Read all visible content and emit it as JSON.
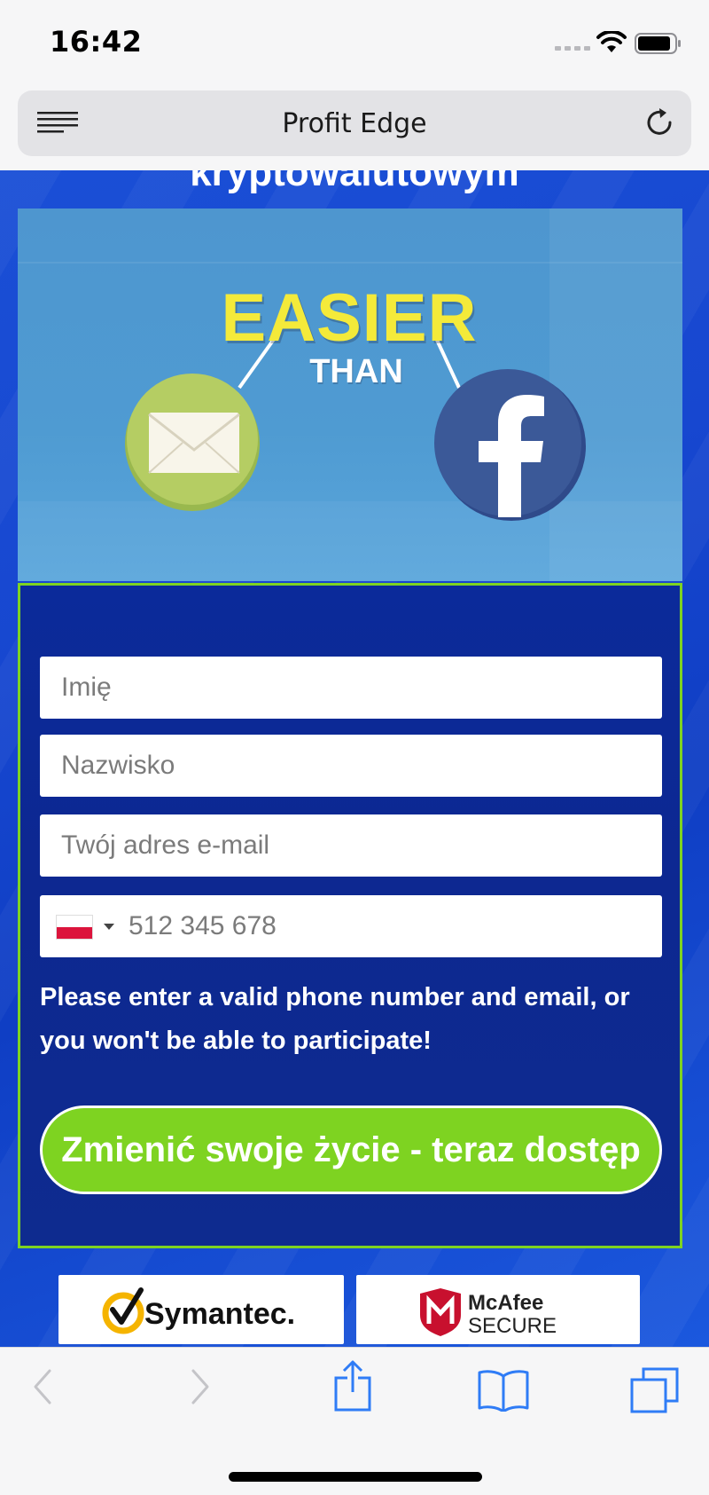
{
  "status_bar": {
    "time": "16:42"
  },
  "browser": {
    "title": "Profit Edge"
  },
  "page": {
    "headline_cut": "kryptowalutowym",
    "hero": {
      "line1": "EASIER",
      "line2": "THAN",
      "left_icon": "envelope-icon",
      "right_icon": "facebook-icon"
    },
    "form": {
      "first_name_placeholder": "Imię",
      "last_name_placeholder": "Nazwisko",
      "email_placeholder": "Twój adres e-mail",
      "phone_placeholder": "512 345 678",
      "country_flag": "pl-flag-icon",
      "warning": "Please enter a valid phone number and email, or you won't be able to participate!",
      "submit_label": "Zmienić swoje życie - teraz dostęp"
    },
    "badges": {
      "symantec": "Symantec.",
      "mcafee_line1": "McAfee",
      "mcafee_line2": "SECURE"
    }
  },
  "toolbar": {
    "icons": [
      "back-icon",
      "forward-icon",
      "share-icon",
      "bookmarks-icon",
      "tabs-icon"
    ]
  },
  "colors": {
    "accent_green": "#7ed321",
    "form_bg": "#0e2b8f",
    "page_blue": "#1747d0",
    "hero_yellow": "#f4ea3a"
  }
}
